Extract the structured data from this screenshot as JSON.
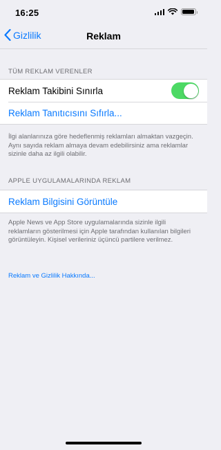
{
  "status_bar": {
    "time": "16:25",
    "battery_level": 0.95
  },
  "nav": {
    "back_label": "Gizlilik",
    "title": "Reklam"
  },
  "section_all_advertisers": {
    "header": "TÜM REKLAM VERENLER",
    "limit_ad_tracking_label": "Reklam Takibini Sınırla",
    "limit_ad_tracking_on": true,
    "reset_identifier_label": "Reklam Tanıtıcısını Sıfırla...",
    "footer": "İlgi alanlarınıza göre hedeflenmiş reklamları almaktan vazgeçin. Aynı sayıda reklam almaya devam edebilirsiniz ama reklamlar sizinle daha az ilgili olabilir."
  },
  "section_apple_apps": {
    "header": "APPLE UYGULAMALARINDA REKLAM",
    "view_ad_info_label": "Reklam Bilgisini Görüntüle",
    "footer": "Apple News ve App Store uygulamalarında sizinle ilgili reklamların gösterilmesi için Apple tarafından kullanılan bilgileri görüntüleyin. Kişisel verileriniz üçüncü partilere verilmez."
  },
  "about_link": "Reklam ve Gizlilik Hakkında...",
  "colors": {
    "accent": "#0a7aff",
    "toggle_on": "#4cd964",
    "background": "#efeff4"
  }
}
